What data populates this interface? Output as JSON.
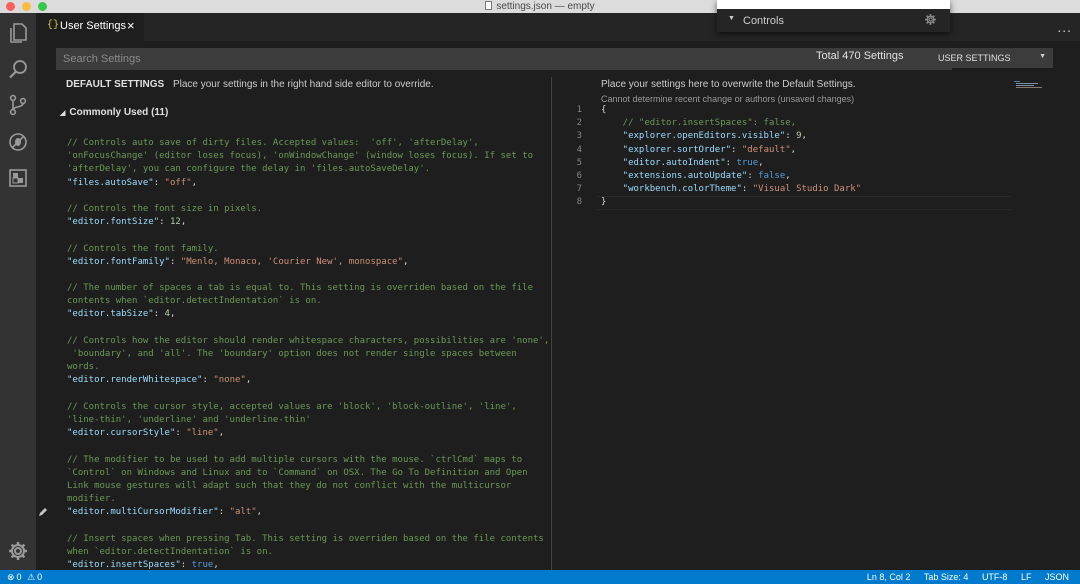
{
  "window": {
    "title": "settings.json — empty"
  },
  "tab": {
    "icon": "{}",
    "label": "User Settings",
    "close": "×"
  },
  "header": {
    "more": "..."
  },
  "controls": {
    "label": "Controls"
  },
  "search": {
    "placeholder": "Search Settings",
    "total": "Total 470 Settings"
  },
  "target": {
    "label": "USER SETTINGS"
  },
  "default_settings": {
    "title": "DEFAULT SETTINGS",
    "description": "Place your settings in the right hand side editor to override.",
    "group_label": "Commonly Used (11)",
    "lines": [
      [
        {
          "c": "c-comment",
          "t": "// Controls auto save of dirty files. Accepted values:  'off', 'afterDelay',"
        }
      ],
      [
        {
          "c": "c-comment",
          "t": "'onFocusChange' (editor loses focus), 'onWindowChange' (window loses focus). If set to"
        }
      ],
      [
        {
          "c": "c-comment",
          "t": "'afterDelay', you can configure the delay in 'files.autoSaveDelay'."
        }
      ],
      [
        {
          "c": "c-key",
          "t": "\"files.autoSave\""
        },
        {
          "c": "c-punc",
          "t": ": "
        },
        {
          "c": "c-str",
          "t": "\"off\""
        },
        {
          "c": "c-punc",
          "t": ","
        }
      ],
      [],
      [
        {
          "c": "c-comment",
          "t": "// Controls the font size in pixels."
        }
      ],
      [
        {
          "c": "c-key",
          "t": "\"editor.fontSize\""
        },
        {
          "c": "c-punc",
          "t": ": "
        },
        {
          "c": "c-num",
          "t": "12"
        },
        {
          "c": "c-punc",
          "t": ","
        }
      ],
      [],
      [
        {
          "c": "c-comment",
          "t": "// Controls the font family."
        }
      ],
      [
        {
          "c": "c-key",
          "t": "\"editor.fontFamily\""
        },
        {
          "c": "c-punc",
          "t": ": "
        },
        {
          "c": "c-str",
          "t": "\"Menlo, Monaco, 'Courier New', monospace\""
        },
        {
          "c": "c-punc",
          "t": ","
        }
      ],
      [],
      [
        {
          "c": "c-comment",
          "t": "// The number of spaces a tab is equal to. This setting is overriden based on the file"
        }
      ],
      [
        {
          "c": "c-comment",
          "t": "contents when `editor.detectIndentation` is on."
        }
      ],
      [
        {
          "c": "c-key",
          "t": "\"editor.tabSize\""
        },
        {
          "c": "c-punc",
          "t": ": "
        },
        {
          "c": "c-num",
          "t": "4"
        },
        {
          "c": "c-punc",
          "t": ","
        }
      ],
      [],
      [
        {
          "c": "c-comment",
          "t": "// Controls how the editor should render whitespace characters, possibilities are 'none',"
        }
      ],
      [
        {
          "c": "c-comment",
          "t": " 'boundary', and 'all'. The 'boundary' option does not render single spaces between"
        }
      ],
      [
        {
          "c": "c-comment",
          "t": "words."
        }
      ],
      [
        {
          "c": "c-key",
          "t": "\"editor.renderWhitespace\""
        },
        {
          "c": "c-punc",
          "t": ": "
        },
        {
          "c": "c-str",
          "t": "\"none\""
        },
        {
          "c": "c-punc",
          "t": ","
        }
      ],
      [],
      [
        {
          "c": "c-comment",
          "t": "// Controls the cursor style, accepted values are 'block', 'block-outline', 'line',"
        }
      ],
      [
        {
          "c": "c-comment",
          "t": "'line-thin', 'underline' and 'underline-thin'"
        }
      ],
      [
        {
          "c": "c-key",
          "t": "\"editor.cursorStyle\""
        },
        {
          "c": "c-punc",
          "t": ": "
        },
        {
          "c": "c-str",
          "t": "\"line\""
        },
        {
          "c": "c-punc",
          "t": ","
        }
      ],
      [],
      [
        {
          "c": "c-comment",
          "t": "// The modifier to be used to add multiple cursors with the mouse. `ctrlCmd` maps to"
        }
      ],
      [
        {
          "c": "c-comment",
          "t": "`Control` on Windows and Linux and to `Command` on OSX. The Go To Definition and Open"
        }
      ],
      [
        {
          "c": "c-comment",
          "t": "Link mouse gestures will adapt such that they do not conflict with the multicursor"
        }
      ],
      [
        {
          "c": "c-comment",
          "t": "modifier."
        }
      ],
      [
        {
          "c": "c-key",
          "t": "\"editor.multiCursorModifier\""
        },
        {
          "c": "c-punc",
          "t": ": "
        },
        {
          "c": "c-str",
          "t": "\"alt\""
        },
        {
          "c": "c-punc",
          "t": ","
        }
      ],
      [],
      [
        {
          "c": "c-comment",
          "t": "// Insert spaces when pressing Tab. This setting is overriden based on the file contents"
        }
      ],
      [
        {
          "c": "c-comment",
          "t": "when `editor.detectIndentation` is on."
        }
      ],
      [
        {
          "c": "c-key",
          "t": "\"editor.insertSpaces\""
        },
        {
          "c": "c-punc",
          "t": ": "
        },
        {
          "c": "c-bool",
          "t": "true"
        },
        {
          "c": "c-punc",
          "t": ","
        }
      ]
    ]
  },
  "user_settings": {
    "description": "Place your settings here to overwrite the Default Settings.",
    "note": "Cannot determine recent change or authors (unsaved changes)",
    "line_numbers": [
      "1",
      "2",
      "3",
      "4",
      "5",
      "6",
      "7",
      "8"
    ],
    "lines": [
      [
        {
          "c": "c-punc",
          "t": "{"
        }
      ],
      [
        {
          "c": "c-comment",
          "t": "    // \"editor.insertSpaces\": false,"
        }
      ],
      [
        {
          "c": "c-key",
          "t": "    \"explorer.openEditors.visible\""
        },
        {
          "c": "c-punc",
          "t": ": "
        },
        {
          "c": "c-num",
          "t": "9"
        },
        {
          "c": "c-punc",
          "t": ","
        }
      ],
      [
        {
          "c": "c-key",
          "t": "    \"explorer.sortOrder\""
        },
        {
          "c": "c-punc",
          "t": ": "
        },
        {
          "c": "c-str",
          "t": "\"default\""
        },
        {
          "c": "c-punc",
          "t": ","
        }
      ],
      [
        {
          "c": "c-key",
          "t": "    \"editor.autoIndent\""
        },
        {
          "c": "c-punc",
          "t": ": "
        },
        {
          "c": "c-bool",
          "t": "true"
        },
        {
          "c": "c-punc",
          "t": ","
        }
      ],
      [
        {
          "c": "c-key",
          "t": "    \"extensions.autoUpdate\""
        },
        {
          "c": "c-punc",
          "t": ": "
        },
        {
          "c": "c-bool",
          "t": "false"
        },
        {
          "c": "c-punc",
          "t": ","
        }
      ],
      [
        {
          "c": "c-key",
          "t": "    \"workbench.colorTheme\""
        },
        {
          "c": "c-punc",
          "t": ": "
        },
        {
          "c": "c-str",
          "t": "\"Visual Studio Dark\""
        }
      ],
      [
        {
          "c": "c-punc",
          "t": "}"
        }
      ]
    ]
  },
  "statusbar": {
    "errors": "0",
    "warnings": "0",
    "position": "Ln 8, Col 2",
    "tab_size": "Tab Size: 4",
    "encoding": "UTF-8",
    "eol": "LF",
    "language": "JSON"
  },
  "activity": [
    "files-icon",
    "search-icon",
    "source-control-icon",
    "debug-icon",
    "extensions-icon",
    "settings-gear-icon"
  ],
  "colors": {
    "accent": "#007acc",
    "editor_bg": "#1e1e1e",
    "activity_bg": "#333333",
    "comment": "#6a9955",
    "key": "#9cdcfe",
    "string": "#ce9178",
    "number": "#b5cea8",
    "keyword": "#569cd6"
  }
}
